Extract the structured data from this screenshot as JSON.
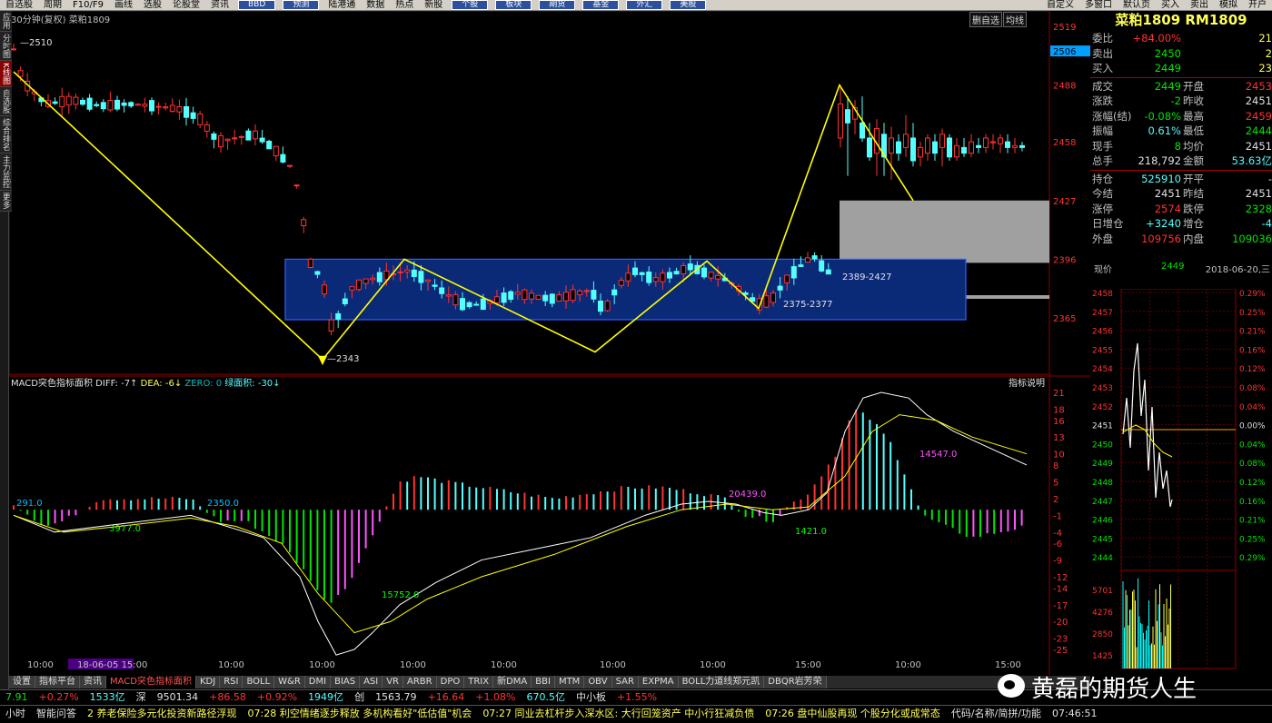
{
  "menu": {
    "items": [
      "自选股",
      "周期",
      "F10/F9",
      "画线",
      "选股",
      "论股堂",
      "资讯"
    ],
    "tool_buttons": [
      "BBD",
      "预测"
    ],
    "items2": [
      "陆港通",
      "数据",
      "热点",
      "新股"
    ],
    "tool_buttons2": [
      "个股",
      "板块",
      "期货",
      "基金",
      "外汇",
      "美股"
    ],
    "items3": [
      "自定义",
      "多窗口",
      "默认页",
      "买入",
      "卖出",
      "模拟",
      "开户"
    ]
  },
  "left_tabs": [
    "应用",
    "分时图",
    "K线图",
    "自选股",
    "综合排名",
    "主力监控",
    "更多"
  ],
  "chart": {
    "period_label": "30分钟(复权)",
    "symbol_label": "菜粕1809",
    "right_buttons": [
      "删自选",
      "均线"
    ],
    "y_labels": [
      "2519",
      "2506",
      "2488",
      "2458",
      "2427",
      "2396",
      "2365"
    ],
    "annotations": {
      "high": "2510",
      "low": "2343",
      "range1": "2389-2427",
      "range2": "2375-2377"
    },
    "time_labels": [
      "10:00",
      "18-06-05 15:00",
      "10:00",
      "10:00",
      "10:00",
      "10:00",
      "10:00",
      "10:00",
      "15:00",
      "10:00",
      "15:00"
    ]
  },
  "macd": {
    "title": "MACD突色指标面积",
    "diff_label": "DIFF: -7↑",
    "dea_label": "DEA: -6↓",
    "zero_label": "ZERO: 0",
    "area_label": "绿面积: -30↓",
    "help_button": "指标说明",
    "y_labels": [
      "21",
      "18",
      "16",
      "13",
      "10",
      "8",
      "5",
      "2",
      "-1",
      "-4",
      "-6",
      "-9",
      "-12",
      "-14",
      "-17",
      "-20",
      "-23",
      "-25"
    ],
    "area_texts": [
      "291.0",
      "2350.0",
      "3977.0",
      "15752.0",
      "20439.0",
      "1421.0",
      "14547.0"
    ]
  },
  "ticker": "菜粕1809 RM1809",
  "quote_rows": [
    {
      "l": "委比",
      "v": "+84.00%",
      "vc": "red",
      "l2": "",
      "v2": "21",
      "v2c": "yellow"
    },
    {
      "l": "卖出",
      "v": "2450",
      "vc": "green",
      "l2": "",
      "v2": "2",
      "v2c": "yellow"
    },
    {
      "l": "买入",
      "v": "2449",
      "vc": "green",
      "l2": "",
      "v2": "23",
      "v2c": "yellow"
    },
    {
      "sep": true
    },
    {
      "l": "成交",
      "v": "2449",
      "vc": "green",
      "l2": "开盘",
      "v2": "2453",
      "v2c": "red"
    },
    {
      "l": "涨跌",
      "v": "-2",
      "vc": "green",
      "l2": "昨收",
      "v2": "2451",
      "v2c": "white"
    },
    {
      "l": "涨幅(结)",
      "v": "-0.08%",
      "vc": "green",
      "l2": "最高",
      "v2": "2459",
      "v2c": "red"
    },
    {
      "l": "振幅",
      "v": "0.61%",
      "vc": "cyan",
      "l2": "最低",
      "v2": "2444",
      "v2c": "green"
    },
    {
      "l": "现手",
      "v": "8",
      "vc": "green",
      "l2": "均价",
      "v2": "2451",
      "v2c": "white"
    },
    {
      "l": "总手",
      "v": "218,792",
      "vc": "white",
      "l2": "金额",
      "v2": "53.63亿",
      "v2c": "cyan"
    },
    {
      "sep": true
    },
    {
      "l": "持仓",
      "v": "525910",
      "vc": "cyan",
      "l2": "开平",
      "v2": "-",
      "v2c": "white"
    },
    {
      "l": "今结",
      "v": "2451",
      "vc": "white",
      "l2": "昨结",
      "v2": "2451",
      "v2c": "white"
    },
    {
      "l": "涨停",
      "v": "2574",
      "vc": "red",
      "l2": "跌停",
      "v2": "2328",
      "v2c": "green"
    },
    {
      "l": "日增仓",
      "v": "+3240",
      "vc": "cyan",
      "l2": "增仓",
      "v2": "-4",
      "v2c": "cyan"
    },
    {
      "l": "外盘",
      "v": "109756",
      "vc": "red",
      "l2": "内盘",
      "v2": "109036",
      "v2c": "green"
    }
  ],
  "now_bar": {
    "label": "现价",
    "price": "2449",
    "date": "2018-06-20,三"
  },
  "mini": {
    "left_labels": [
      "2458",
      "2457",
      "2456",
      "2455",
      "2454",
      "2453",
      "2452",
      "2451",
      "2450",
      "2449",
      "2448",
      "2447",
      "2446",
      "2445",
      "2444"
    ],
    "right_labels": [
      "0.29%",
      "0.25%",
      "0.21%",
      "0.16%",
      "0.12%",
      "0.08%",
      "0.04%",
      "0.00%",
      "0.04%",
      "0.08%",
      "0.12%",
      "0.16%",
      "0.21%",
      "0.25%",
      "0.29%"
    ],
    "vol_labels": [
      "5701",
      "4276",
      "2850",
      "1425"
    ]
  },
  "tabs": [
    "设置",
    "指标平台",
    "资讯",
    "MACD突色指标面积",
    "KDJ",
    "RSI",
    "BOLL",
    "W&R",
    "DMI",
    "BIAS",
    "ASI",
    "VR",
    "ARBR",
    "DPO",
    "TRIX",
    "新DMA",
    "BBI",
    "MTM",
    "OBV",
    "SAR",
    "EXPMA",
    "BOLL力道线郑元凯",
    "DBQR岩芳荣"
  ],
  "index_bar": [
    {
      "t": "7.91",
      "c": "green"
    },
    {
      "t": "+0.27%",
      "c": "red"
    },
    {
      "t": "1533亿",
      "c": "cyan"
    },
    {
      "t": "深",
      "c": "white"
    },
    {
      "t": "9501.34",
      "c": "white"
    },
    {
      "t": "+86.58",
      "c": "red"
    },
    {
      "t": "+0.92%",
      "c": "red"
    },
    {
      "t": "1949亿",
      "c": "cyan"
    },
    {
      "t": "创",
      "c": "white"
    },
    {
      "t": "1563.79",
      "c": "white"
    },
    {
      "t": "+16.64",
      "c": "red"
    },
    {
      "t": "+1.08%",
      "c": "red"
    },
    {
      "t": "670.5亿",
      "c": "cyan"
    },
    {
      "t": "中小板",
      "c": "white"
    },
    {
      "t": "+1.55%",
      "c": "red"
    }
  ],
  "news_bar": [
    {
      "t": "小时",
      "c": "white"
    },
    {
      "t": "智能问答",
      "c": "white"
    },
    {
      "t": "2 养老保险多元化投资新路径浮现",
      "c": "yellow"
    },
    {
      "t": "07:28 利空情绪逐步释放 多机构看好\"低估值\"机会",
      "c": "yellow"
    },
    {
      "t": "07:27 同业去杠杆步入深水区: 大行回笼资产 中小行狂减负债",
      "c": "yellow"
    },
    {
      "t": "07:26 盘中仙股再现 个股分化或成常态",
      "c": "yellow"
    },
    {
      "t": "代码/名称/简拼/功能",
      "c": "white"
    },
    {
      "t": "07:46:51",
      "c": "white"
    }
  ],
  "watermark": "黄磊的期货人生",
  "colors": {
    "up": "#ff3232",
    "down": "#54ffff",
    "box": "#0a2a78",
    "trend": "#ffff00",
    "gray": "#a0a0a0"
  }
}
